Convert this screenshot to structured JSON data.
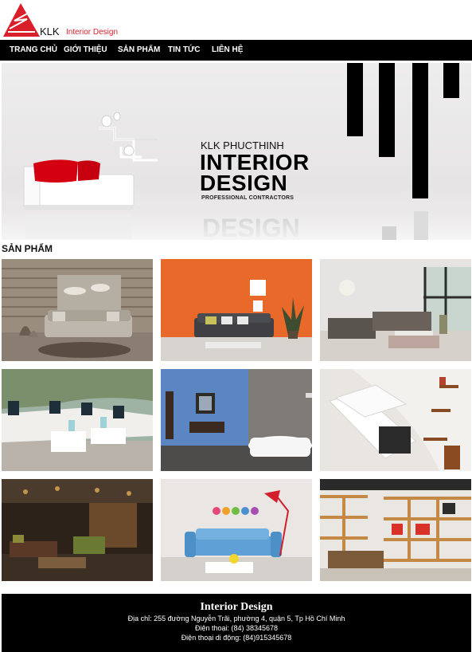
{
  "brand": {
    "name": "KLK",
    "tagline": "Interior Design",
    "accent_color": "#d9202a"
  },
  "nav": {
    "items": [
      {
        "label": "TRANG CHỦ"
      },
      {
        "label": "GIỚI THIỆU"
      },
      {
        "label": "SẢN PHẨM"
      },
      {
        "label": "TIN TỨC"
      },
      {
        "label": "LIÊN HỆ"
      }
    ]
  },
  "banner": {
    "kicker": "KLK PHUCTHINH",
    "line1": "INTERIOR",
    "line2": "DESIGN",
    "line3": "PROFESSIONAL CONTRACTORS",
    "reflection": "DESIGN"
  },
  "products": {
    "heading": "SẢN PHẨM",
    "items": [
      {
        "icon": "living-room-wood-wall-photo"
      },
      {
        "icon": "living-room-orange-wall-photo"
      },
      {
        "icon": "living-room-window-photo"
      },
      {
        "icon": "outdoor-terrace-photo"
      },
      {
        "icon": "bathroom-blue-wall-photo"
      },
      {
        "icon": "white-sectional-sofa-photo"
      },
      {
        "icon": "dark-lounge-photo"
      },
      {
        "icon": "blue-sofa-red-lamp-photo"
      },
      {
        "icon": "office-bookshelf-photo"
      }
    ]
  },
  "footer": {
    "title": "Interior Design",
    "address": "Địa chỉ: 255 đường Nguyễn Trãi, phường 4, quận 5, Tp Hồ Chí Minh",
    "phone": "Điện thoại: (84) 38345678",
    "mobile": "Điện thoại di động: (84)915345678"
  }
}
